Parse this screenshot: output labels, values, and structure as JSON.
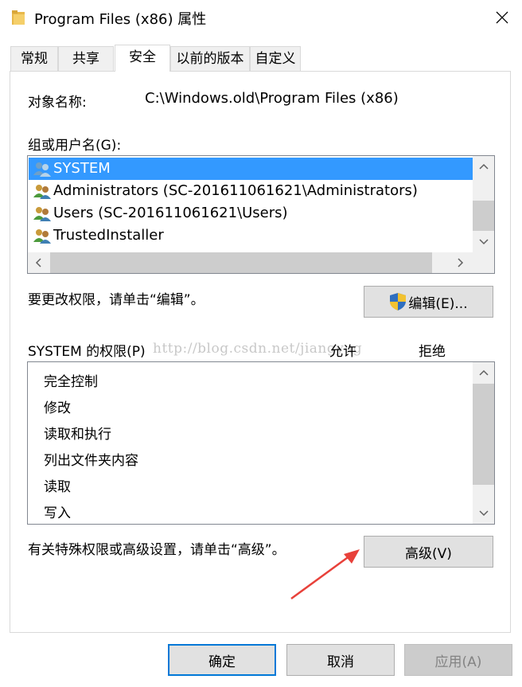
{
  "window": {
    "title": "Program Files (x86) 属性",
    "close_glyph": "✕"
  },
  "tabs": [
    {
      "label": "常规"
    },
    {
      "label": "共享"
    },
    {
      "label": "安全",
      "active": true
    },
    {
      "label": "以前的版本"
    },
    {
      "label": "自定义"
    }
  ],
  "object": {
    "label": "对象名称:",
    "value": "C:\\Windows.old\\Program Files (x86)"
  },
  "groups": {
    "label": "组或用户名(G):",
    "items": [
      {
        "name": "SYSTEM",
        "selected": true
      },
      {
        "name": "Administrators (SC-201611061621\\Administrators)"
      },
      {
        "name": "Users (SC-201611061621\\Users)"
      },
      {
        "name": "TrustedInstaller"
      }
    ]
  },
  "edit": {
    "hint": "要更改权限，请单击“编辑”。",
    "button_label": "编辑(E)..."
  },
  "permissions": {
    "label": "SYSTEM 的权限(P)",
    "allow_header": "允许",
    "deny_header": "拒绝",
    "items": [
      "完全控制",
      "修改",
      "读取和执行",
      "列出文件夹内容",
      "读取",
      "写入"
    ]
  },
  "watermark": "http://blog.csdn.net/jiangyug",
  "advanced": {
    "hint": "有关特殊权限或高级设置，请单击“高级”。",
    "button_label": "高级(V)"
  },
  "footer": {
    "ok_label": "确定",
    "cancel_label": "取消",
    "apply_label": "应用(A)"
  },
  "colors": {
    "selection": "#3399ff",
    "accent": "#0078d7",
    "arrow": "#e8413a"
  },
  "scroll": {
    "up_glyph": "⌃",
    "down_glyph": "⌄",
    "left_glyph": "‹",
    "right_glyph": "›"
  }
}
